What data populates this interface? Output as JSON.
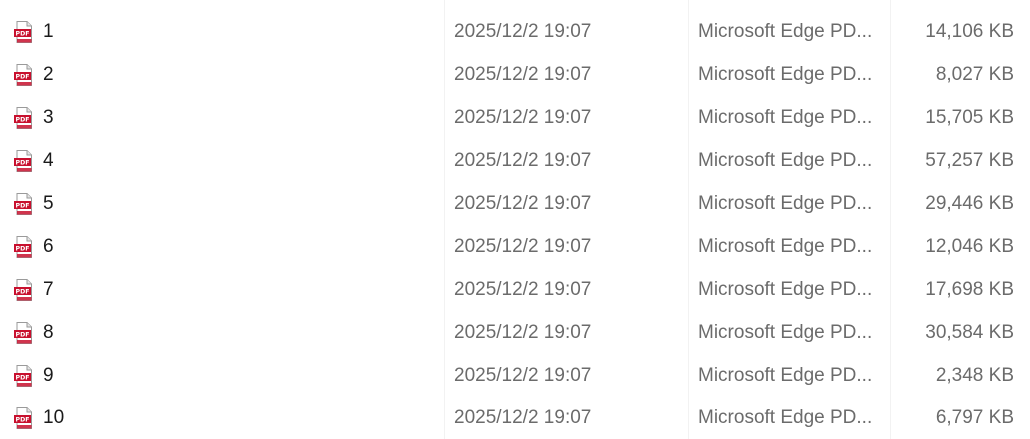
{
  "files": [
    {
      "name": "1",
      "modified": "2025/12/2 19:07",
      "type": "Microsoft Edge PD...",
      "size": "14,106 KB",
      "icon": "pdf-icon"
    },
    {
      "name": "2",
      "modified": "2025/12/2 19:07",
      "type": "Microsoft Edge PD...",
      "size": "8,027 KB",
      "icon": "pdf-icon"
    },
    {
      "name": "3",
      "modified": "2025/12/2 19:07",
      "type": "Microsoft Edge PD...",
      "size": "15,705 KB",
      "icon": "pdf-icon"
    },
    {
      "name": "4",
      "modified": "2025/12/2 19:07",
      "type": "Microsoft Edge PD...",
      "size": "57,257 KB",
      "icon": "pdf-icon"
    },
    {
      "name": "5",
      "modified": "2025/12/2 19:07",
      "type": "Microsoft Edge PD...",
      "size": "29,446 KB",
      "icon": "pdf-icon"
    },
    {
      "name": "6",
      "modified": "2025/12/2 19:07",
      "type": "Microsoft Edge PD...",
      "size": "12,046 KB",
      "icon": "pdf-icon"
    },
    {
      "name": "7",
      "modified": "2025/12/2 19:07",
      "type": "Microsoft Edge PD...",
      "size": "17,698 KB",
      "icon": "pdf-icon"
    },
    {
      "name": "8",
      "modified": "2025/12/2 19:07",
      "type": "Microsoft Edge PD...",
      "size": "30,584 KB",
      "icon": "pdf-icon"
    },
    {
      "name": "9",
      "modified": "2025/12/2 19:07",
      "type": "Microsoft Edge PD...",
      "size": "2,348 KB",
      "icon": "pdf-icon"
    },
    {
      "name": "10",
      "modified": "2025/12/2 19:07",
      "type": "Microsoft Edge PD...",
      "size": "6,797 KB",
      "icon": "pdf-icon"
    }
  ],
  "colors": {
    "pdf_icon_red": "#c8102e",
    "secondary_text": "#6b6b6b",
    "primary_text": "#1a1a1a"
  }
}
